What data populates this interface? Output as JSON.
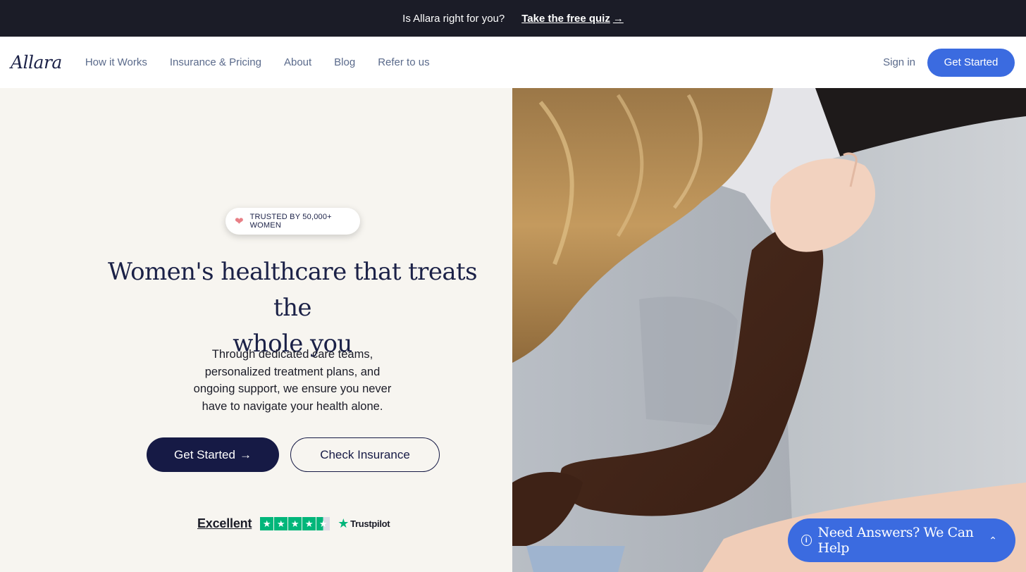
{
  "topbar": {
    "question": "Is Allara right for you?",
    "quiz_link": "Take the free quiz",
    "arrow": "→"
  },
  "nav": {
    "logo": "Allara",
    "links": [
      "How it Works",
      "Insurance & Pricing",
      "About",
      "Blog",
      "Refer to us"
    ],
    "sign_in": "Sign in",
    "cta": "Get Started"
  },
  "hero": {
    "badge": "TRUSTED BY 50,000+ WOMEN",
    "headline_line1": "Women's healthcare that treats the",
    "headline_line2": "whole you",
    "subtitle": "Through dedicated care teams, personalized treatment plans, and ongoing support, we ensure you never have to navigate your health alone.",
    "primary_cta": "Get Started",
    "primary_arrow": "→",
    "secondary_cta": "Check Insurance"
  },
  "trustpilot": {
    "rating_text": "Excellent",
    "stars": 4.5,
    "brand": "Trustpilot"
  },
  "help_widget": {
    "label": "Need Answers? We Can Help"
  },
  "colors": {
    "topbar_bg": "#1b1c27",
    "brand_blue": "#3b6be0",
    "navy": "#161a45",
    "hero_bg": "#f7f5f0",
    "trustpilot_green": "#00b67a"
  }
}
